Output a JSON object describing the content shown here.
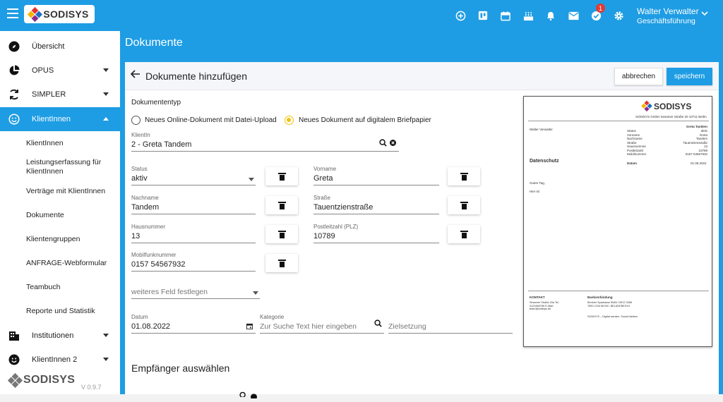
{
  "topbar": {
    "logo_text": "SODISYS",
    "icons": [
      "plus-circle-icon",
      "board-icon",
      "calendar-icon",
      "cake-icon",
      "bell-icon",
      "mail-icon",
      "task-check-icon",
      "settings-icon"
    ],
    "task_badge": "1",
    "user_name": "Walter Verwalter",
    "user_role": "Geschäftsführung"
  },
  "sidebar": {
    "items": [
      {
        "label": "Übersicht"
      },
      {
        "label": "OPUS"
      },
      {
        "label": "SIMPLER"
      },
      {
        "label": "KlientInnen"
      },
      {
        "label": "Institutionen"
      },
      {
        "label": "KlientInnen 2"
      }
    ],
    "subitems": [
      "KlientInnen",
      "Leistungserfassung für KlientInnen",
      "Verträge mit KlientInnen",
      "Dokumente",
      "Klientengruppen",
      "ANFRAGE-Webformular",
      "Teambuch",
      "Reporte und Statistik"
    ],
    "logo_text": "SODISYS",
    "version": "V 0.9.7"
  },
  "page": {
    "title": "Dokumente"
  },
  "card": {
    "title": "Dokumente hinzufügen",
    "cancel": "abbrechen",
    "save": "speichern"
  },
  "form": {
    "doc_type_label": "Dokumententyp",
    "radio1": "Neues Online-Dokument mit Datei-Upload",
    "radio2": "Neues Dokument auf digitalem Briefpapier",
    "client_label": "KlientIn",
    "client_value": "2 - Greta Tandem",
    "status_label": "Status",
    "status_value": "aktiv",
    "vorname_label": "Vorname",
    "vorname_value": "Greta",
    "nachname_label": "Nachname",
    "nachname_value": "Tandem",
    "strasse_label": "Straße",
    "strasse_value": "Tauentzienstraße",
    "hausnummer_label": "Hausnummer",
    "hausnummer_value": "13",
    "plz_label": "Postleitzahl (PLZ)",
    "plz_value": "10789",
    "mobil_label": "Mobilfunknummer",
    "mobil_value": "0157 54567932",
    "weiteres_placeholder": "weiteres Feld festlegen",
    "datum_label": "Datum",
    "datum_value": "01.08.2022",
    "kategorie_label": "Kategorie",
    "kategorie_placeholder": "Zur Suche Text hier eingeben",
    "zielsetzung_placeholder": "Zielsetzung",
    "recipients_title": "Empfänger auswählen"
  },
  "preview": {
    "logo_text": "SODISYS",
    "address_line": "SODISYS GmbH Sesamer Straße 20 10711 Berlin",
    "sender": "Walter Verwalter",
    "recipient_name": "Greta Tandem",
    "rows": [
      {
        "k": "Status",
        "v": "aktiv"
      },
      {
        "k": "Vorname",
        "v": "Greta"
      },
      {
        "k": "Nachname",
        "v": "Tandem"
      },
      {
        "k": "Straße",
        "v": "Tauentzienstraße"
      },
      {
        "k": "Hausnummer",
        "v": "13"
      },
      {
        "k": "Postleitzahl",
        "v": "10789"
      },
      {
        "k": "Mobilnummer",
        "v": "0157 54567932"
      }
    ],
    "doc_title": "Datenschutz",
    "datum_label": "Datum",
    "datum_value": "01.08.2022",
    "greeting": "Guten Tag,",
    "body": "Hier ist",
    "footer_contact_title": "KONTAKT",
    "footer_contact_lines": [
      "Sesamer Straße 20a Tel.",
      "0123456789 E-Mail:",
      "team@sodisys.de"
    ],
    "footer_bank_title": "Bankverbindung",
    "footer_bank_lines": [
      "Berliner Sparkasse IBAN: DE12 3456",
      "7890 1234 56 BIC: BELADEBEXXX"
    ],
    "footer_slogan": "SODISYS – Digital werden. Sozial bleiben."
  },
  "colors": {
    "primary": "#1e9de4",
    "accent": "#f4c20d",
    "badge": "#e53935"
  }
}
